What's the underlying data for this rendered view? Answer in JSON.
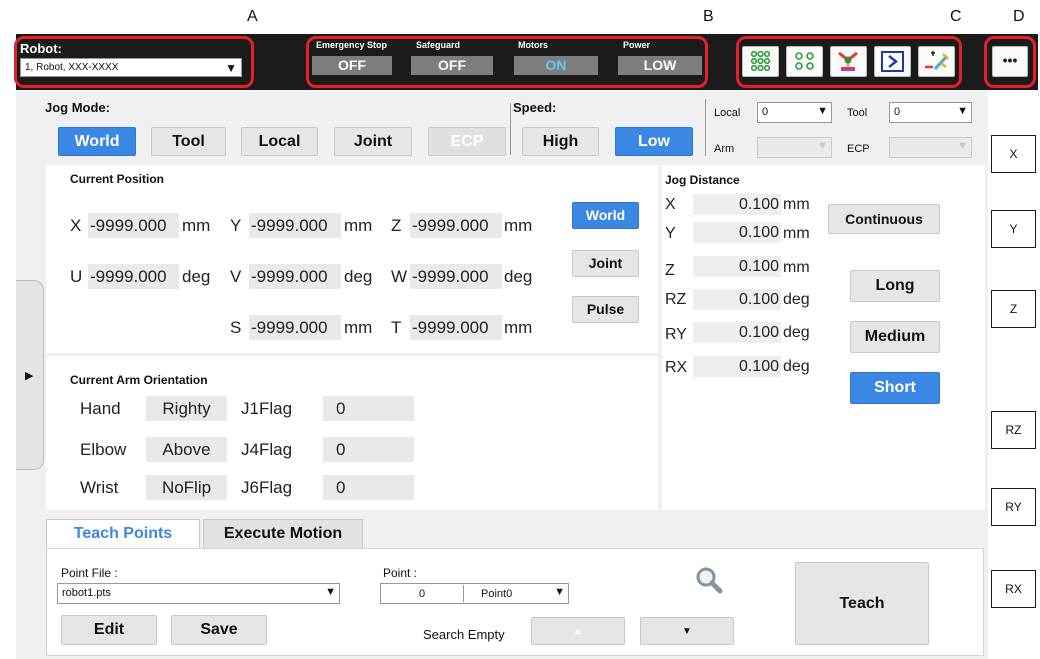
{
  "callouts": {
    "a": "A",
    "b": "B",
    "c": "C",
    "d": "D"
  },
  "topbar": {
    "robot_label": "Robot:",
    "robot_value": "1, Robot, XXX-XXXX",
    "status": [
      {
        "label": "Emergency Stop",
        "value": "OFF"
      },
      {
        "label": "Safeguard",
        "value": "OFF"
      },
      {
        "label": "Motors",
        "value": "ON"
      },
      {
        "label": "Power",
        "value": "LOW"
      }
    ],
    "tool_icons": [
      "io-monitor-icon",
      "io-small-icon",
      "robot-arm-icon",
      "terminal-command-icon",
      "hand-tool-icon"
    ],
    "more_label": "•••"
  },
  "jog": {
    "mode_label": "Jog Mode:",
    "modes": [
      "World",
      "Tool",
      "Local",
      "Joint",
      "ECP"
    ],
    "speed_label": "Speed:",
    "speeds": [
      "High",
      "Low"
    ],
    "local_label": "Local",
    "local_value": "0",
    "tool_label": "Tool",
    "tool_value": "0",
    "arm_label": "Arm",
    "arm_value": "",
    "ecp_label": "ECP",
    "ecp_value": ""
  },
  "position": {
    "title": "Current Position",
    "rows": [
      [
        {
          "ax": "X",
          "val": "-9999.000",
          "unit": "mm"
        },
        {
          "ax": "Y",
          "val": "-9999.000",
          "unit": "mm"
        },
        {
          "ax": "Z",
          "val": "-9999.000",
          "unit": "mm"
        }
      ],
      [
        {
          "ax": "U",
          "val": "-9999.000",
          "unit": "deg"
        },
        {
          "ax": "V",
          "val": "-9999.000",
          "unit": "deg"
        },
        {
          "ax": "W",
          "val": "-9999.000",
          "unit": "deg"
        }
      ],
      [
        {
          "ax": "S",
          "val": "-9999.000",
          "unit": "mm"
        },
        {
          "ax": "T",
          "val": "-9999.000",
          "unit": "mm"
        }
      ]
    ],
    "display_modes": [
      "World",
      "Joint",
      "Pulse"
    ]
  },
  "orientation": {
    "title": "Current Arm Orientation",
    "rows": [
      {
        "name": "Hand",
        "value": "Righty",
        "flag": "J1Flag",
        "flag_value": "0"
      },
      {
        "name": "Elbow",
        "value": "Above",
        "flag": "J4Flag",
        "flag_value": "0"
      },
      {
        "name": "Wrist",
        "value": "NoFlip",
        "flag": "J6Flag",
        "flag_value": "0"
      }
    ]
  },
  "jog_distance": {
    "title": "Jog Distance",
    "rows": [
      {
        "ax": "X",
        "val": "0.100",
        "unit": "mm"
      },
      {
        "ax": "Y",
        "val": "0.100",
        "unit": "mm"
      },
      {
        "ax": "Z",
        "val": "0.100",
        "unit": "mm"
      },
      {
        "ax": "RZ",
        "val": "0.100",
        "unit": "deg"
      },
      {
        "ax": "RY",
        "val": "0.100",
        "unit": "deg"
      },
      {
        "ax": "RX",
        "val": "0.100",
        "unit": "deg"
      }
    ],
    "modes": [
      "Continuous",
      "Long",
      "Medium",
      "Short"
    ]
  },
  "axis_buttons": [
    "X",
    "Y",
    "Z",
    "RZ",
    "RY",
    "RX"
  ],
  "tabs": [
    "Teach Points",
    "Execute Motion"
  ],
  "teach": {
    "point_file_label": "Point File :",
    "point_file_value": "robot1.pts",
    "edit_label": "Edit",
    "save_label": "Save",
    "point_label": "Point :",
    "point_number": "0",
    "point_name": "Point0",
    "search_empty_label": "Search Empty",
    "up_glyph": "▲",
    "down_glyph": "▼",
    "teach_label": "Teach"
  },
  "colors": {
    "accent": "#3a88e3",
    "topbar": "#1b1b1b",
    "callout": "#e5202a",
    "motors_on": "#66c9f2"
  }
}
